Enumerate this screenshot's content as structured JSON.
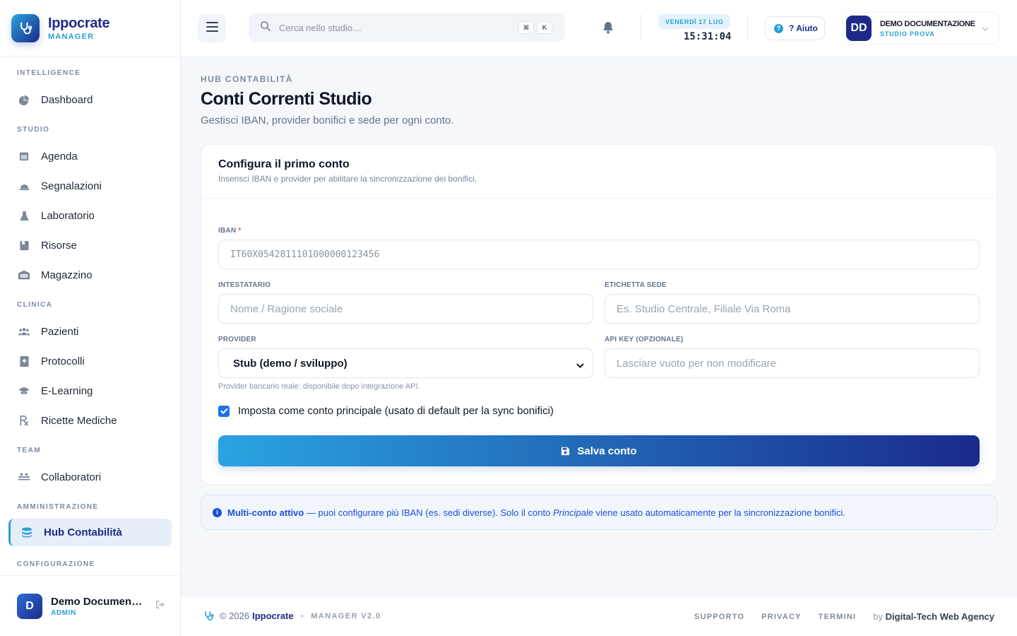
{
  "brand": {
    "name": "Ippocrate",
    "sub": "MANAGER"
  },
  "sidebar": {
    "sections": {
      "intelligence": "INTELLIGENCE",
      "studio": "STUDIO",
      "clinica": "CLINICA",
      "team": "TEAM",
      "amministrazione": "AMMINISTRAZIONE",
      "configurazione": "CONFIGURAZIONE"
    },
    "items": {
      "dashboard": "Dashboard",
      "agenda": "Agenda",
      "segnalazioni": "Segnalazioni",
      "laboratorio": "Laboratorio",
      "risorse": "Risorse",
      "magazzino": "Magazzino",
      "pazienti": "Pazienti",
      "protocolli": "Protocolli",
      "elearning": "E-Learning",
      "ricette": "Ricette Mediche",
      "collaboratori": "Collaboratori",
      "hub": "Hub Contabilità"
    },
    "user": {
      "initial": "D",
      "name": "Demo Documentazione",
      "role": "ADMIN"
    }
  },
  "topbar": {
    "search_placeholder": "Cerca nello studio…",
    "kbd_cmd": "⌘",
    "kbd_k": "K",
    "date": "VENERDÌ 17 LUG",
    "time": "15:31:04",
    "help": "? Aiuto",
    "profile": {
      "initials": "DD",
      "name": "DEMO DOCUMENTAZIONE",
      "studio": "STUDIO PROVA"
    }
  },
  "page": {
    "breadcrumb": "HUB CONTABILITÀ",
    "title": "Conti Correnti Studio",
    "subtitle": "Gestisci IBAN, provider bonifici e sede per ogni conto."
  },
  "form": {
    "title": "Configura il primo conto",
    "subtitle": "Inserisci IBAN e provider per abilitare la sincronizzazione dei bonifici.",
    "iban_label": "IBAN",
    "iban_required": "*",
    "iban_placeholder": "IT60X0542811101000000123456",
    "intestatario_label": "INTESTATARIO",
    "intestatario_placeholder": "Nome / Ragione sociale",
    "sede_label": "ETICHETTA SEDE",
    "sede_placeholder": "Es. Studio Centrale, Filiale Via Roma",
    "provider_label": "PROVIDER",
    "provider_value": "Stub (demo / sviluppo)",
    "provider_hint": "Provider bancario reale: disponibile dopo integrazione API.",
    "apikey_label": "API KEY (OPZIONALE)",
    "apikey_placeholder": "Lasciare vuoto per non modificare",
    "principale_label": "Imposta come conto principale (usato di default per la sync bonifici)",
    "principale_checked": true,
    "save_label": "Salva conto"
  },
  "info": {
    "bold": "Multi-conto attivo",
    "text1": " — puoi configurare più IBAN (es. sedi diverse). Solo il conto ",
    "italic": "Principale",
    "text2": " viene usato automaticamente per la sincronizzazione bonifici."
  },
  "footer": {
    "copyright": "© 2026",
    "brand": "Ippocrate",
    "sep": "•",
    "version": "MANAGER V2.0",
    "links": {
      "support": "SUPPORTO",
      "privacy": "PRIVACY",
      "terms": "TERMINI"
    },
    "by_prefix": "by",
    "by_name": "Digital-Tech Web Agency"
  },
  "colors": {
    "primary": "#1e2a8a",
    "accent": "#2a9fd8",
    "checkbox": "#1a73e8"
  }
}
